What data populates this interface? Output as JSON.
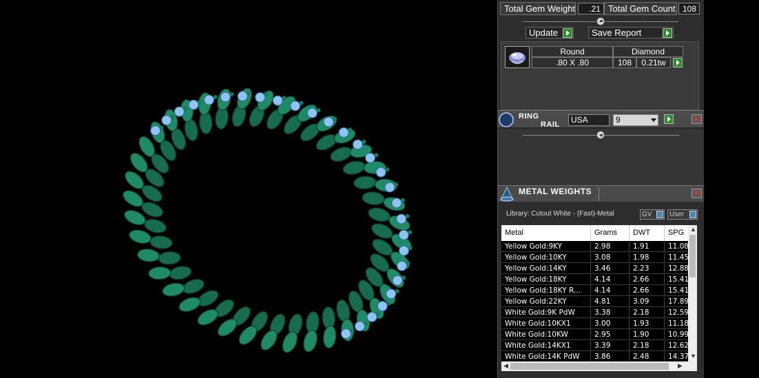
{
  "gem_totals": {
    "weight_label": "Total Gem Weight",
    "weight_value": ".21",
    "count_label": "Total Gem Count",
    "count_value": "108"
  },
  "buttons": {
    "update_label": "Update",
    "save_report_label": "Save Report"
  },
  "gem_detail": {
    "shape": "Round",
    "size": ".80 X .80",
    "stone": "Diamond",
    "count": "108",
    "weight": "0.21tw"
  },
  "ring_rail": {
    "title_line1": "RING",
    "title_line2": "RAIL",
    "standard": "USA",
    "size": "9"
  },
  "metal_weights": {
    "title": "METAL WEIGHTS",
    "library_label": "Library: Cutout White - (Fast)-Metal",
    "toggle_gv": "GV",
    "toggle_user": "User",
    "columns": [
      "Metal",
      "Grams",
      "DWT",
      "SPG"
    ],
    "rows": [
      [
        "Yellow Gold:9KY",
        "2.98",
        "1.91",
        "11.08"
      ],
      [
        "Yellow Gold:10KY",
        "3.08",
        "1.98",
        "11.45"
      ],
      [
        "Yellow Gold:14KY",
        "3.46",
        "2.23",
        "12.88"
      ],
      [
        "Yellow Gold:18KY",
        "4.14",
        "2.66",
        "15.41"
      ],
      [
        "Yellow Gold:18KY R...",
        "4.14",
        "2.66",
        "15.41"
      ],
      [
        "Yellow Gold:22KY",
        "4.81",
        "3.09",
        "17.89"
      ],
      [
        "White Gold:9K PdW",
        "3.38",
        "2.18",
        "12.59"
      ],
      [
        "White Gold:10KX1",
        "3.00",
        "1.93",
        "11.18"
      ],
      [
        "White Gold:10KW",
        "2.95",
        "1.90",
        "10.99"
      ],
      [
        "White Gold:14KX1",
        "3.39",
        "2.18",
        "12.62"
      ],
      [
        "White Gold:14K PdW",
        "3.86",
        "2.48",
        "14.37"
      ]
    ]
  },
  "colors": {
    "panel_bg": "#2d2d2d",
    "ring_metal": "#1f8a66",
    "gem": "#8ec3f5",
    "go_button": "#2e8a2e"
  },
  "icons": [
    "chevron-up-icon",
    "play-icon",
    "gem-thumbnail-icon",
    "ring-icon",
    "close-icon",
    "chevron-down-icon",
    "metal-scale-icon"
  ]
}
